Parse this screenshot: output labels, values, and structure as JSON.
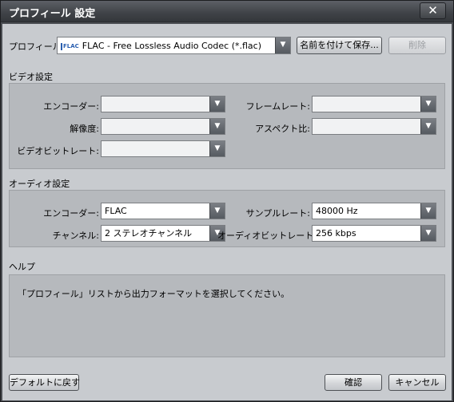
{
  "window": {
    "title": "プロフィール 設定"
  },
  "profile": {
    "label": "プロフィール:",
    "value": "FLAC - Free Lossless Audio Codec (*.flac)",
    "icon_text": "FLAC",
    "save_as": "名前を付けて保存...",
    "delete": "削除"
  },
  "video": {
    "section": "ビデオ設定",
    "encoder_label": "エンコーダー:",
    "encoder_value": "",
    "framerate_label": "フレームレート:",
    "framerate_value": "",
    "resolution_label": "解像度:",
    "resolution_value": "",
    "aspect_label": "アスペクト比:",
    "aspect_value": "",
    "bitrate_label": "ビデオビットレート:",
    "bitrate_value": ""
  },
  "audio": {
    "section": "オーディオ設定",
    "encoder_label": "エンコーダー:",
    "encoder_value": "FLAC",
    "samplerate_label": "サンプルレート:",
    "samplerate_value": "48000 Hz",
    "channel_label": "チャンネル:",
    "channel_value": "2 ステレオチャンネル",
    "bitrate_label": "オーディオビットレート:",
    "bitrate_value": "256 kbps"
  },
  "help": {
    "section": "ヘルプ",
    "text": "「プロフィール」リストから出力フォーマットを選択してください。"
  },
  "footer": {
    "default": "デフォルトに戻す",
    "ok": "確認",
    "cancel": "キャンセル"
  },
  "icons": {
    "close": "✕",
    "dropdown_arrow": "▼"
  }
}
